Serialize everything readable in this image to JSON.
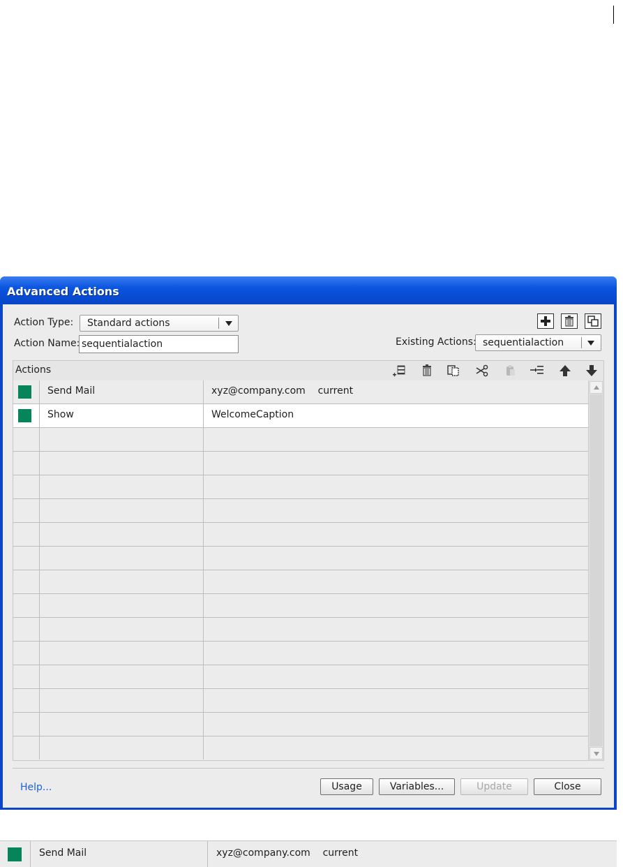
{
  "dialog": {
    "title": "Advanced Actions",
    "action_type_label": "Action Type:",
    "action_type_value": "Standard actions",
    "action_name_label": "Action Name:",
    "action_name_value": "sequentialaction",
    "existing_actions_label": "Existing Actions:",
    "existing_actions_value": "sequentialaction",
    "actions_header": "Actions",
    "top_icons": [
      "add-icon",
      "trash-icon",
      "duplicate-icon"
    ],
    "toolbar_icons": [
      "insert-row-icon",
      "trash-icon",
      "copy-icon",
      "cut-icon",
      "paste-icon",
      "indent-icon",
      "arrow-up-icon",
      "arrow-down-icon"
    ],
    "rows": [
      {
        "action": "Send Mail",
        "target": "xyz@company.com    current",
        "status_color": "#06855a"
      },
      {
        "action": "Show",
        "target": "WelcomeCaption",
        "status_color": "#06855a"
      }
    ],
    "help_link": "Help...",
    "buttons": {
      "usage": "Usage",
      "variables": "Variables...",
      "update": "Update",
      "close": "Close"
    }
  },
  "excerpt_row": {
    "action": "Send Mail",
    "target": "xyz@company.com    current",
    "status_color": "#06855a"
  }
}
